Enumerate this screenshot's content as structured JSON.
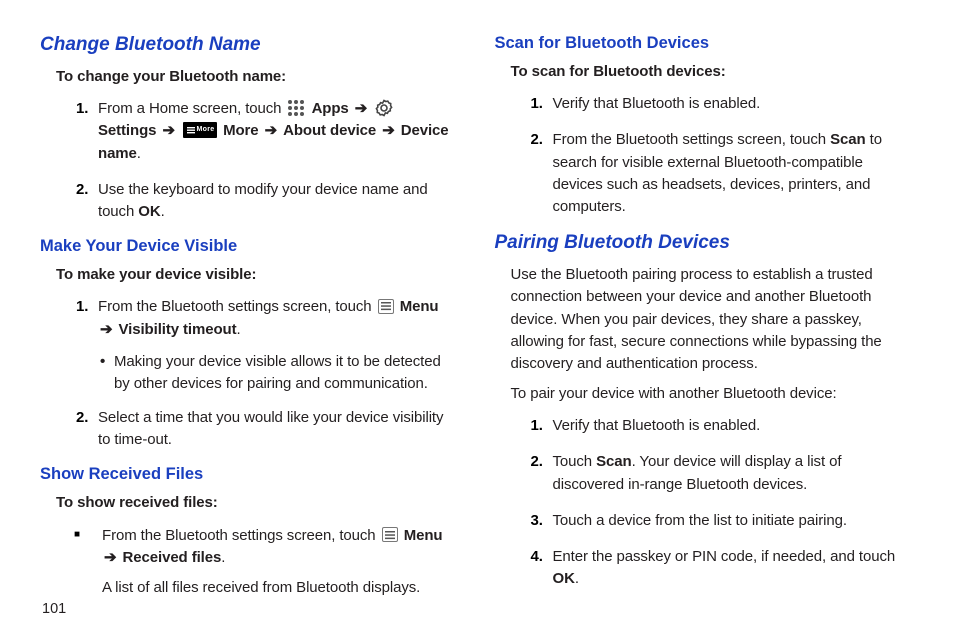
{
  "left": {
    "section1_title": "Change Bluetooth Name",
    "section1_intro": "To change your Bluetooth name:",
    "step1_a": "From a Home screen, touch ",
    "step1_b": " Apps",
    "step1_c": " Settings",
    "step1_d": " More",
    "step1_e": " About device",
    "step1_f": " Device name",
    "step2_a": "Use the keyboard to modify your device name and touch ",
    "step2_b": "OK",
    "section2_title": "Make Your Device Visible",
    "section2_intro": "To make your device visible:",
    "step3_a": "From the Bluetooth settings screen, touch ",
    "step3_b": " Menu",
    "step3_c": " Visibility timeout",
    "bullet1": "Making your device visible allows it to be detected by other devices for pairing and communication.",
    "step4": "Select a time that you would like your device visibility to time-out.",
    "section3_title": "Show Received Files",
    "section3_intro": "To show received files:",
    "sq1_a": "From the Bluetooth settings screen, touch ",
    "sq1_b": " Menu",
    "sq1_c": " Received files",
    "sub1": "A list of all files received from Bluetooth displays.",
    "page_num": "101"
  },
  "right": {
    "section1_title": "Scan for Bluetooth Devices",
    "section1_intro": "To scan for Bluetooth devices:",
    "step1": "Verify that Bluetooth is enabled.",
    "step2_a": "From the Bluetooth settings screen, touch ",
    "step2_b": "Scan",
    "step2_c": " to search for visible external Bluetooth-compatible devices such as headsets, devices, printers, and computers.",
    "section2_title": "Pairing Bluetooth Devices",
    "para1": "Use the Bluetooth pairing process to establish a trusted connection between your device and another Bluetooth device. When you pair devices, they share a passkey, allowing for fast, secure connections while bypassing the discovery and authentication process.",
    "para2": "To pair your device with another Bluetooth device:",
    "step3": "Verify that Bluetooth is enabled.",
    "step4_a": "Touch ",
    "step4_b": "Scan",
    "step4_c": ". Your device will display a list of discovered in-range Bluetooth devices.",
    "step5": "Touch a device from the list to initiate pairing.",
    "step6_a": "Enter the passkey or PIN code, if needed, and touch ",
    "step6_b": "OK"
  },
  "arrow": "➔",
  "more_label": "More"
}
